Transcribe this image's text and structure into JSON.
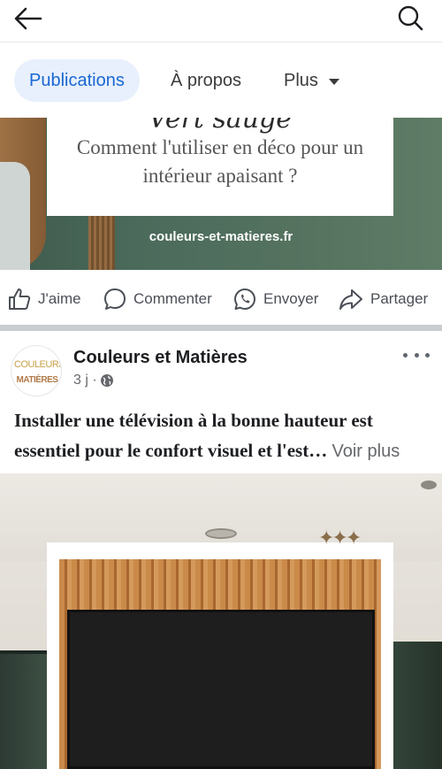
{
  "header": {
    "back_icon": "arrow-left-icon",
    "search_icon": "search-icon"
  },
  "tabs": [
    {
      "label": "Publications",
      "active": true
    },
    {
      "label": "À propos",
      "active": false
    },
    {
      "label": "Plus",
      "active": false
    }
  ],
  "previous_post": {
    "card_title_partial": "Vert sauge",
    "card_subtitle": "Comment l'utiliser en déco pour un intérieur apaisant ?",
    "site_caption": "couleurs-et-matieres.fr"
  },
  "actions": {
    "like": "J'aime",
    "comment": "Commenter",
    "send": "Envoyer",
    "share": "Partager"
  },
  "post": {
    "page_name": "Couleurs et Matières",
    "avatar_line1": "COULEURS",
    "avatar_line2": "MATIÈRES",
    "time": "3 j ·",
    "text": "Installer une télévision à la bonne hauteur est essentiel pour le confort visuel et l'est…",
    "see_more": "Voir plus"
  },
  "colors": {
    "accent": "#1967d2",
    "active_tab_bg": "#e7f0fc",
    "muted_text": "#65676b"
  }
}
